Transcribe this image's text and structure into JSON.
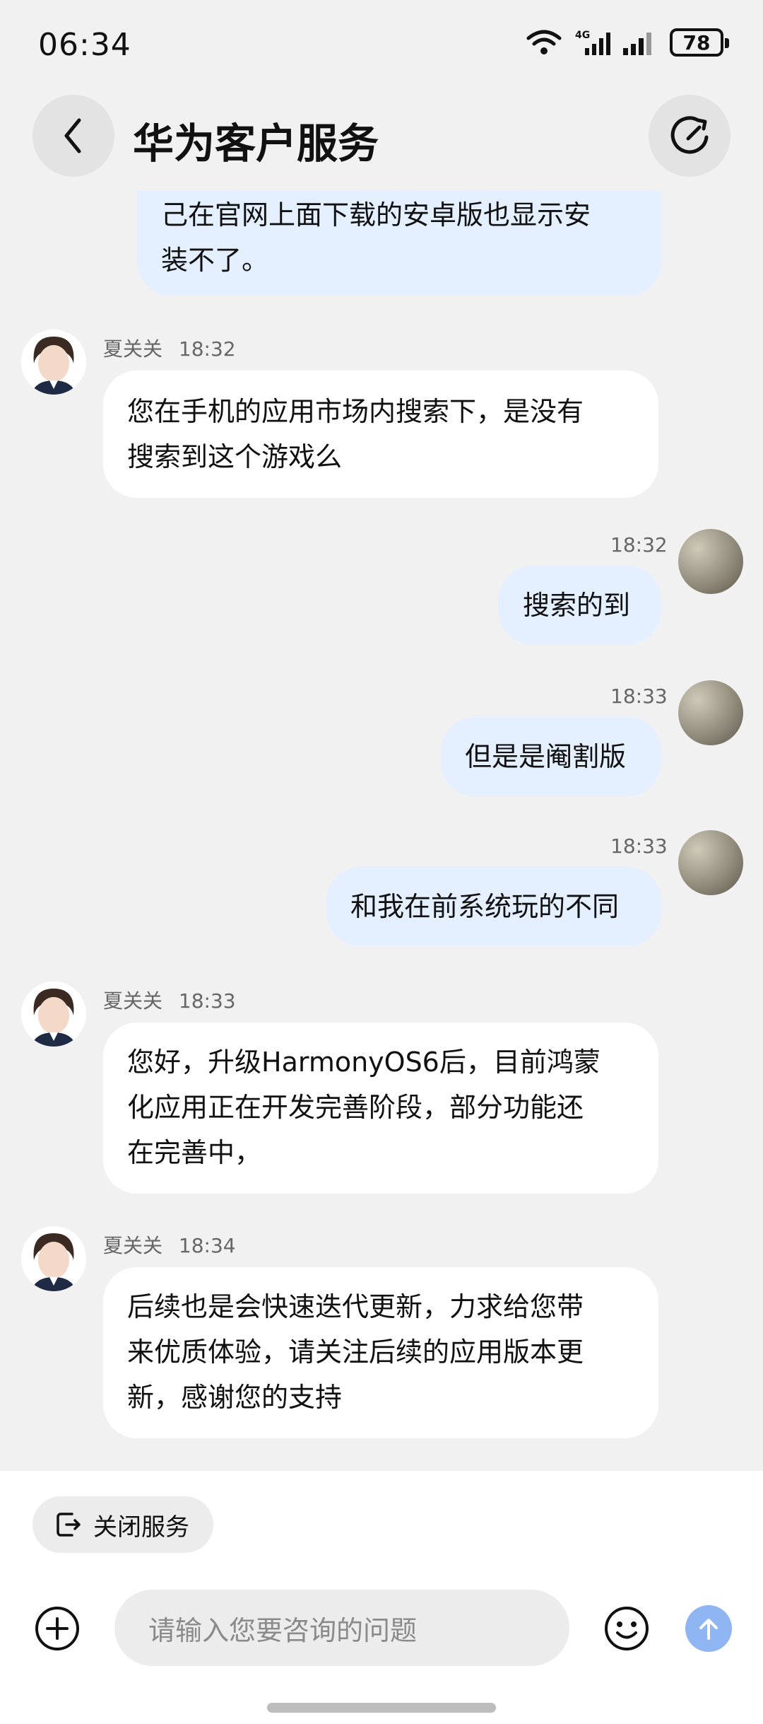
{
  "status": {
    "time": "06:34",
    "battery": "78",
    "network": "4G"
  },
  "header": {
    "title": "华为客户服务"
  },
  "messages": [
    {
      "from": "user",
      "text_lines": [
        "己在官网上面下载的安卓版也显示安",
        "装不了。"
      ]
    },
    {
      "from": "agent",
      "name": "夏关关",
      "time": "18:32",
      "text_lines": [
        "您在手机的应用市场内搜索下，是没有",
        "搜索到这个游戏么"
      ]
    },
    {
      "from": "user",
      "time": "18:32",
      "text_lines": [
        "搜索的到"
      ]
    },
    {
      "from": "user",
      "time": "18:33",
      "text_lines": [
        "但是是阉割版"
      ]
    },
    {
      "from": "user",
      "time": "18:33",
      "text_lines": [
        "和我在前系统玩的不同"
      ]
    },
    {
      "from": "agent",
      "name": "夏关关",
      "time": "18:33",
      "text_lines": [
        "您好，升级HarmonyOS6后，目前鸿蒙",
        "化应用正在开发完善阶段，部分功能还",
        "在完善中，"
      ]
    },
    {
      "from": "agent",
      "name": "夏关关",
      "time": "18:34",
      "text_lines": [
        "后续也是会快速迭代更新，力求给您带",
        "来优质体验，请关注后续的应用版本更",
        "新，感谢您的支持"
      ]
    }
  ],
  "chip": {
    "label": "关闭服务"
  },
  "input": {
    "placeholder": "请输入您要咨询的问题"
  },
  "colors": {
    "user_bubble": "#e4efff",
    "agent_bubble": "#ffffff",
    "send_button": "#8fb5f2"
  },
  "icons": [
    "back-icon",
    "refresh-icon",
    "exit-icon",
    "add-icon",
    "emoji-icon",
    "send-arrow-icon"
  ]
}
